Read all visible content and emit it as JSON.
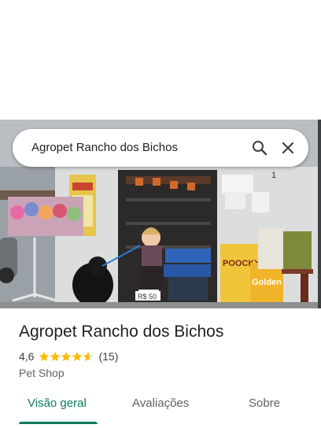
{
  "search": {
    "query": "Agropet Rancho dos Bichos"
  },
  "place": {
    "name": "Agropet Rancho dos Bichos",
    "rating": "4,6",
    "rating_fraction": 0.92,
    "review_count": "(15)",
    "category": "Pet Shop"
  },
  "photo": {
    "sign_poocky": "POOCKY",
    "sign_golden": "Golden",
    "price_tag": "R$ 50"
  },
  "tabs": [
    {
      "label": "Visão geral",
      "active": true
    },
    {
      "label": "Avaliações",
      "active": false
    },
    {
      "label": "Sobre",
      "active": false
    }
  ],
  "colors": {
    "accent": "#0b7a5a",
    "star": "#fbbc04",
    "star_empty": "#dadce0"
  },
  "icons": {
    "search": "search-icon",
    "close": "close-icon",
    "star": "star-icon"
  }
}
